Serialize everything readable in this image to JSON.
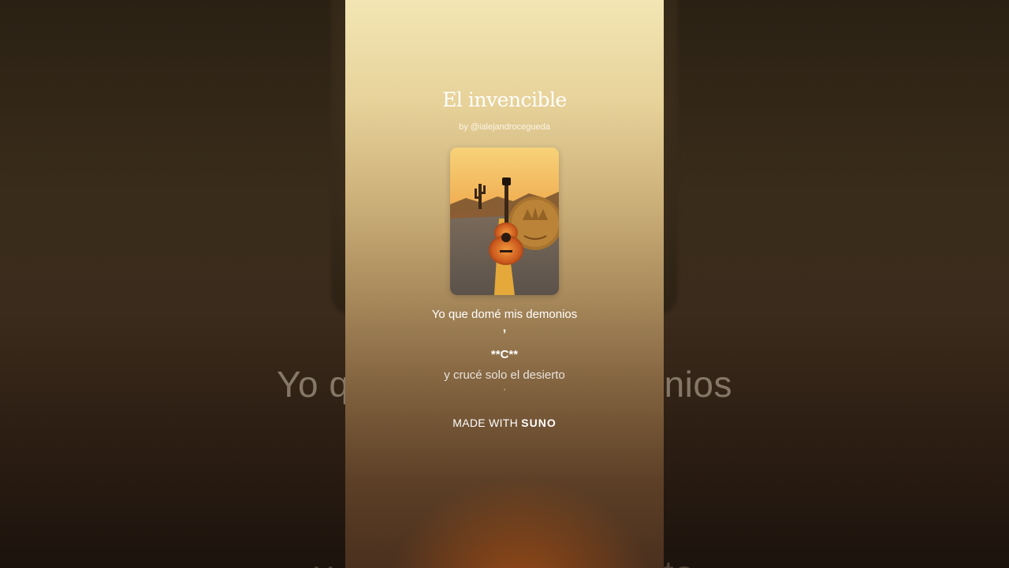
{
  "song": {
    "title": "El invencible",
    "byline": "by @ialejandrocegueda"
  },
  "cover": {
    "icon": "guitar-road-desert-artwork"
  },
  "lyrics": {
    "current": "Yo que domé mis demonios",
    "current_comma": ",",
    "marker": "**C**",
    "next": "y crucé solo el desierto",
    "next_comma": ","
  },
  "backdrop": {
    "lyric_line": "Yo que domé mis demonios",
    "lyric_line_2": "y crucé solo el desierto"
  },
  "footer": {
    "made_with": "MADE WITH",
    "brand": "SUNO"
  },
  "colors": {
    "panel_top": "#f3e6b4",
    "panel_bottom": "#4a301e",
    "text": "#ffffff"
  }
}
